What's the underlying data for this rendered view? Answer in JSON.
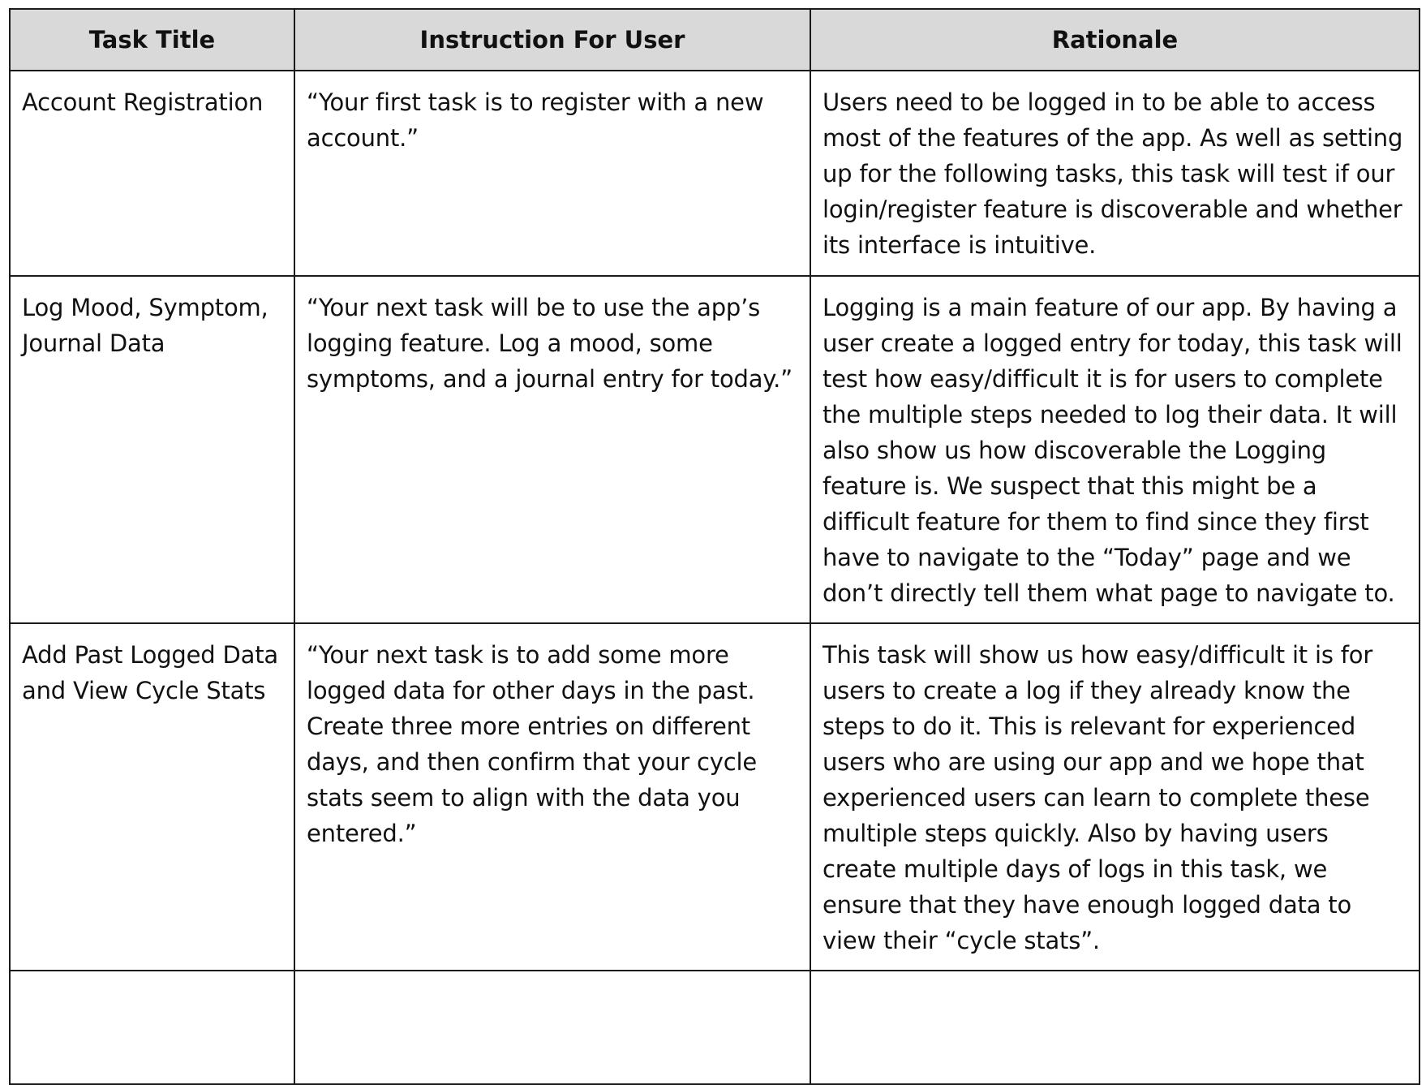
{
  "table": {
    "headers": [
      "Task Title",
      "Instruction For User",
      "Rationale"
    ],
    "rows": [
      {
        "title": "Account Registration",
        "instruction": "“Your first task is to register with a new account.”",
        "rationale": "Users need to be logged in to be able to access most of the features of the app. As well as setting up for the following tasks, this task will test if our login/register feature is discoverable and whether its interface is intuitive."
      },
      {
        "title": "Log Mood, Symptom, Journal Data",
        "instruction": "“Your next task will be to use the app’s logging feature. Log a mood, some symptoms, and a journal entry for today.”",
        "rationale": "Logging is a main feature of our app. By having a user create a logged entry for today, this task will test how easy/difficult it is for users to complete the multiple steps needed to log their data. It will also show us how discoverable the Logging feature is. We suspect that this might be a difficult feature for them to find since they first have to navigate to the “Today” page and we don’t directly tell them what page to navigate to."
      },
      {
        "title": "Add Past Logged Data and View Cycle Stats",
        "instruction": "“Your next task is to add some more logged data for other days in the past. Create three more entries on different days, and then confirm that your cycle stats seem to align with the data you entered.”",
        "rationale": "This task will show us how easy/difficult it is for users to create a log if they already know the steps to do it. This is relevant for experienced users who are using our app and we hope that experienced users can learn to complete these multiple steps quickly. Also by having users create multiple days of logs in this task, we ensure that they have enough logged data to view their “cycle stats”."
      }
    ]
  }
}
